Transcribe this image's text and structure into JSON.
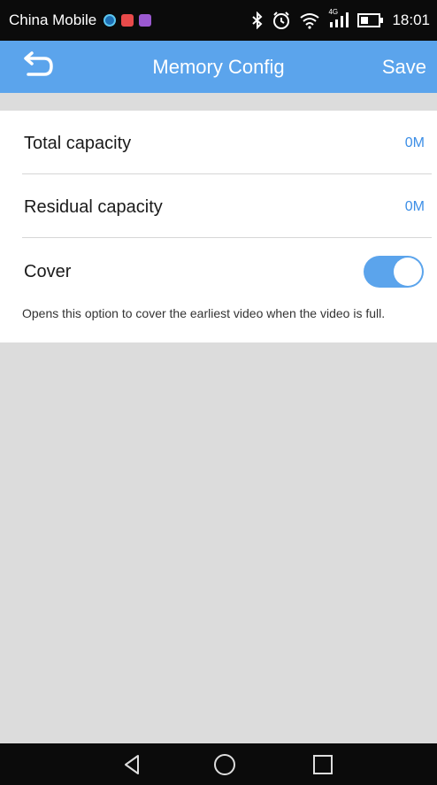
{
  "status_bar": {
    "carrier": "China Mobile",
    "time": "18:01",
    "network": "4G",
    "icons": [
      "app-notification-icon",
      "bluetooth-icon",
      "alarm-icon",
      "wifi-icon",
      "signal-icon",
      "battery-icon"
    ]
  },
  "toolbar": {
    "title": "Memory Config",
    "save_label": "Save",
    "back_icon": "back-arrow-icon"
  },
  "settings": {
    "total_capacity": {
      "label": "Total capacity",
      "value": "0M"
    },
    "residual_capacity": {
      "label": "Residual capacity",
      "value": "0M"
    },
    "cover": {
      "label": "Cover",
      "enabled": true,
      "hint": "Opens this option to cover the earliest video when the video is full."
    }
  },
  "nav_bar": {
    "icons": [
      "nav-back-icon",
      "nav-home-icon",
      "nav-recents-icon"
    ]
  },
  "colors": {
    "accent": "#5ba4ec",
    "value_text": "#3c8ee6",
    "background": "#dcdcdc"
  }
}
